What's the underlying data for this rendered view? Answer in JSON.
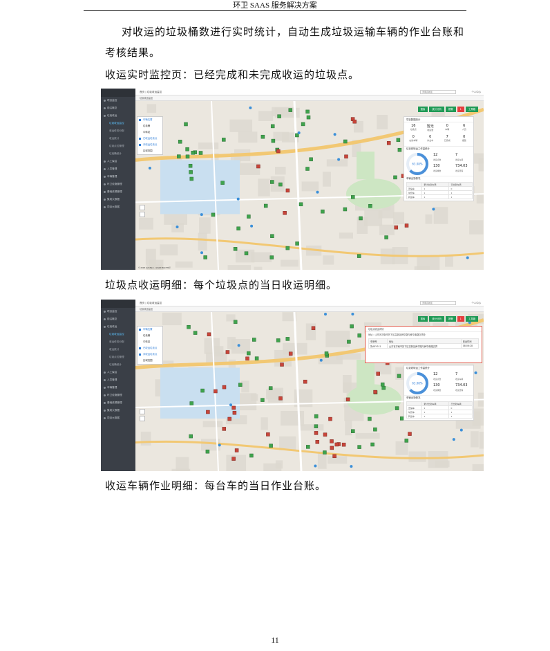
{
  "header": {
    "title": "环卫 SAAS 服务解决方案"
  },
  "paragraph": {
    "line1": "对收运的垃圾桶数进行实时统计，自动生成垃圾运输车辆的作业台账和",
    "line2": "考核结果。"
  },
  "captions": {
    "monitor": "收运实时监控页：已经完成和未完成收运的垃圾点。",
    "point_detail": "垃圾点收运明细：每个垃圾点的当日收运明细。",
    "vehicle_detail": "收运车辆作业明细：每台车的当日作业台账。"
  },
  "screenshot": {
    "sidebar": [
      {
        "label": "项目监控",
        "sub": false,
        "active": false
      },
      {
        "label": "前沿概念",
        "sub": false,
        "active": false
      },
      {
        "label": "垃圾收运",
        "sub": false,
        "active": false
      },
      {
        "label": "垃圾收运监控",
        "sub": true,
        "active": true
      },
      {
        "label": "收运任务分配",
        "sub": true,
        "active": false
      },
      {
        "label": "收运统计",
        "sub": true,
        "active": false
      },
      {
        "label": "垃圾点位管理",
        "sub": true,
        "active": false
      },
      {
        "label": "垃圾桶统计",
        "sub": true,
        "active": false
      },
      {
        "label": "人工保洁",
        "sub": false,
        "active": false
      },
      {
        "label": "人员管理",
        "sub": false,
        "active": false
      },
      {
        "label": "车辆管理",
        "sub": false,
        "active": false
      },
      {
        "label": "环卫设施管理",
        "sub": false,
        "active": false
      },
      {
        "label": "基础资源管理",
        "sub": false,
        "active": false
      },
      {
        "label": "集成大数据",
        "sub": false,
        "active": false
      },
      {
        "label": "项目大数据",
        "sub": false,
        "active": false
      }
    ],
    "breadcrumb": "首页  |  垃圾收运监控",
    "tab_label": "垃圾收运监控",
    "search_placeholder": "济南高新区",
    "user_label": "个人中心",
    "legend": [
      {
        "label": "车辆位置",
        "blue": true
      },
      {
        "label": "垃圾桶",
        "blue": false
      },
      {
        "label": "中转站",
        "blue": false
      },
      {
        "label": "已收运垃圾点",
        "blue": true
      },
      {
        "label": "未收运垃圾点",
        "blue": true
      },
      {
        "label": "区域范围",
        "blue": false
      }
    ],
    "buttons": [
      {
        "label": "搜索",
        "red": false
      },
      {
        "label": "统计分析",
        "red": false
      },
      {
        "label": "报警",
        "red": false
      },
      {
        "label": "1",
        "red": true
      },
      {
        "label": "工具箱",
        "red": false
      }
    ],
    "panel": {
      "title": "项目数据统计",
      "stats": [
        {
          "value": "16",
          "label": "垃圾点"
        },
        {
          "value": "暂无",
          "label": "收运量"
        },
        {
          "value": "0",
          "label": "车辆"
        },
        {
          "value": "6",
          "label": "人员"
        },
        {
          "value": "0",
          "label": "在线车辆"
        },
        {
          "value": "0",
          "label": "作业中"
        },
        {
          "value": "7",
          "label": "已完成"
        },
        {
          "value": "0",
          "label": "报警"
        }
      ],
      "transfer_title": "垃圾收转运工作量统计",
      "percent": "63.08%",
      "percent_value": 0.6308,
      "k1": "12",
      "k1_label": "收运点数",
      "k2": "7",
      "k2_label": "收运车辆",
      "k3": "130",
      "k3_label": "收运桶数",
      "k4": "734.03",
      "k4_label": "收运里程",
      "vehicle_title": "车辆出勤情况",
      "table_head": [
        "",
        "累计出勤车辆",
        "已出勤车辆"
      ],
      "table_rows": [
        [
          "压缩车",
          "1",
          "0"
        ],
        [
          "勾臂车",
          "1",
          "1"
        ],
        [
          "转运车",
          "1",
          "1"
        ]
      ]
    },
    "detail": {
      "title": "垃圾点收运详情",
      "address": "地址：山东省济南市历下区高新区舜华路与舜华南路交界处",
      "head": [
        "车牌号",
        "地址",
        "收运时间"
      ],
      "row": [
        "鲁A8Y741",
        "山东省济南市历下区高新区舜华路与舜华南路交界",
        "08:06:28"
      ]
    },
    "map_copyright": "© 2018 AutoNavi - GS(2018)1709号"
  },
  "page_number": "11",
  "colors": {
    "sidebar": "#3a3f47",
    "accent_green": "#1f9a55",
    "alert_red": "#e53e3e",
    "link_blue": "#2f7ed8"
  }
}
